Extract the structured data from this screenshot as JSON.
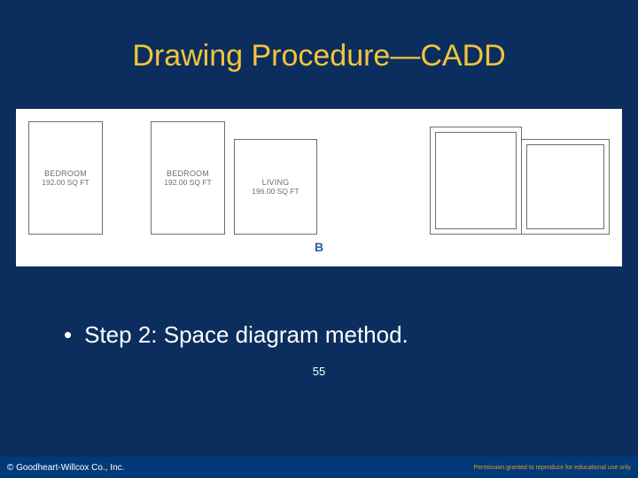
{
  "title": "Drawing Procedure—CADD",
  "figure": {
    "label": "B",
    "rooms": [
      {
        "name": "BEDROOM",
        "area": "192.00 SQ FT"
      },
      {
        "name": "BEDROOM",
        "area": "192.00 SQ FT"
      },
      {
        "name": "LIVING",
        "area": "196.00 SQ FT"
      }
    ]
  },
  "bullet": "Step 2: Space diagram method.",
  "slide_number": "55",
  "footer": {
    "copyright": "© Goodheart-Willcox Co., Inc.",
    "permission": "Permission granted to reproduce for educational use only"
  }
}
